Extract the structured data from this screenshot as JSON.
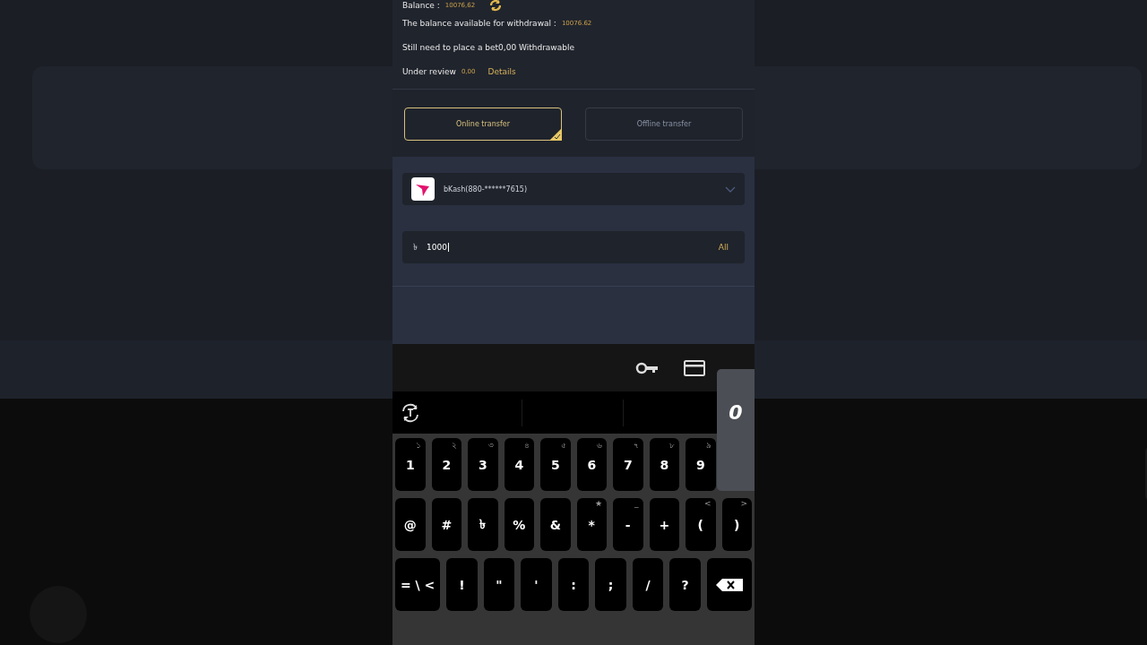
{
  "info": {
    "balance": {
      "label": "Balance :",
      "value": "10076,62"
    },
    "available": {
      "label": "The balance available for withdrawal :",
      "value": "10076.62"
    },
    "bet_line": "Still need to place a bet0,00 Withdrawable",
    "review": {
      "label": "Under review",
      "value": "0,00",
      "link": "Details"
    }
  },
  "transfer_tabs": [
    {
      "label": "Online transfer",
      "selected": true
    },
    {
      "label": "Offline transfer",
      "selected": false
    }
  ],
  "account": {
    "label": "bKash(880-******7615)"
  },
  "amount": {
    "currency": "৳",
    "value": "1000",
    "action": "All"
  },
  "keyboard": {
    "popup": "0",
    "rows": [
      [
        {
          "label": "1",
          "hint": "১"
        },
        {
          "label": "2",
          "hint": "২"
        },
        {
          "label": "3",
          "hint": "৩"
        },
        {
          "label": "4",
          "hint": "৪"
        },
        {
          "label": "5",
          "hint": "৫"
        },
        {
          "label": "6",
          "hint": "৬"
        },
        {
          "label": "7",
          "hint": "৭"
        },
        {
          "label": "8",
          "hint": "৮"
        },
        {
          "label": "9",
          "hint": "৯"
        }
      ],
      [
        {
          "label": "@"
        },
        {
          "label": "#"
        },
        {
          "label": "৳"
        },
        {
          "label": "%"
        },
        {
          "label": "&"
        },
        {
          "label": "*",
          "hint": "★"
        },
        {
          "label": "-",
          "hint": "_"
        },
        {
          "label": "+"
        },
        {
          "label": "(",
          "hint": "<"
        },
        {
          "label": ")",
          "hint": ">"
        }
      ],
      [
        {
          "label": "= \\ <",
          "kind": "wide"
        },
        {
          "label": "!"
        },
        {
          "label": "\""
        },
        {
          "label": "'"
        },
        {
          "label": ":"
        },
        {
          "label": ";"
        },
        {
          "label": "/"
        },
        {
          "label": "?"
        },
        {
          "kind": "backspace"
        }
      ]
    ]
  }
}
